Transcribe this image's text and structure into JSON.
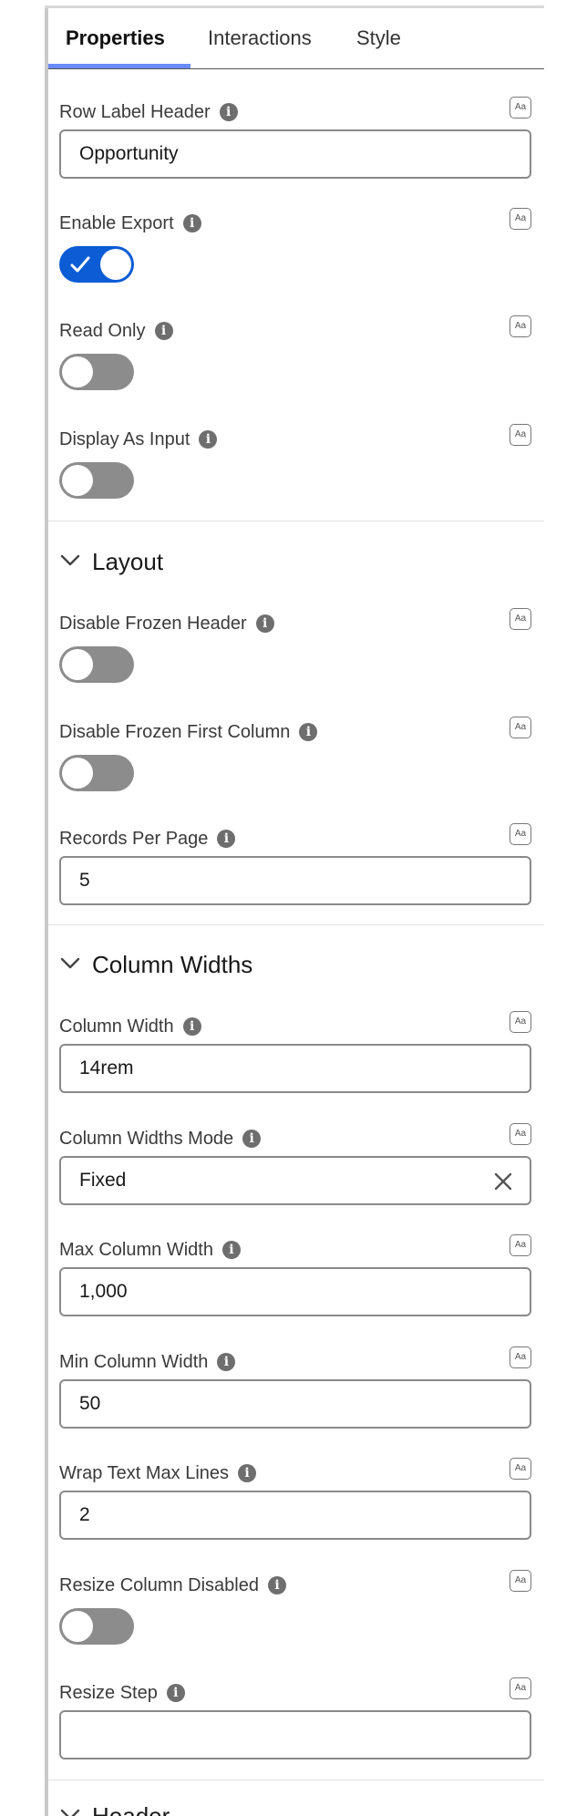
{
  "tabs": [
    {
      "label": "Properties",
      "active": true
    },
    {
      "label": "Interactions",
      "active": false
    },
    {
      "label": "Style",
      "active": false
    }
  ],
  "fields": {
    "row_label_header": {
      "label": "Row Label Header",
      "value": "Opportunity"
    },
    "enable_export": {
      "label": "Enable Export",
      "checked": true
    },
    "read_only": {
      "label": "Read Only",
      "checked": false
    },
    "display_as_input": {
      "label": "Display As Input",
      "checked": false
    },
    "disable_frozen_header": {
      "label": "Disable Frozen Header",
      "checked": false
    },
    "disable_frozen_first_column": {
      "label": "Disable Frozen First Column",
      "checked": false
    },
    "records_per_page": {
      "label": "Records Per Page",
      "value": "5"
    },
    "column_width": {
      "label": "Column Width",
      "value": "14rem"
    },
    "column_widths_mode": {
      "label": "Column Widths Mode",
      "value": "Fixed"
    },
    "max_column_width": {
      "label": "Max Column Width",
      "value": "1,000"
    },
    "min_column_width": {
      "label": "Min Column Width",
      "value": "50"
    },
    "wrap_text_max_lines": {
      "label": "Wrap Text Max Lines",
      "value": "2"
    },
    "resize_column_disabled": {
      "label": "Resize Column Disabled",
      "checked": false
    },
    "resize_step": {
      "label": "Resize Step",
      "value": ""
    }
  },
  "sections": {
    "layout": {
      "title": "Layout",
      "expanded": true
    },
    "column_widths": {
      "title": "Column Widths",
      "expanded": true
    },
    "header": {
      "title": "Header",
      "expanded": true
    }
  },
  "icons": {
    "info": "info-icon",
    "formula": "aa-icon",
    "chevron": "chevron-down-icon",
    "clear": "close-icon",
    "check": "check-icon"
  },
  "colors": {
    "toggle_on": "#0b5cd5",
    "toggle_off": "#8c8c8c",
    "tab_underline": "#6a8bff"
  },
  "glyphs": {
    "info": "i",
    "formula": "Aa"
  }
}
